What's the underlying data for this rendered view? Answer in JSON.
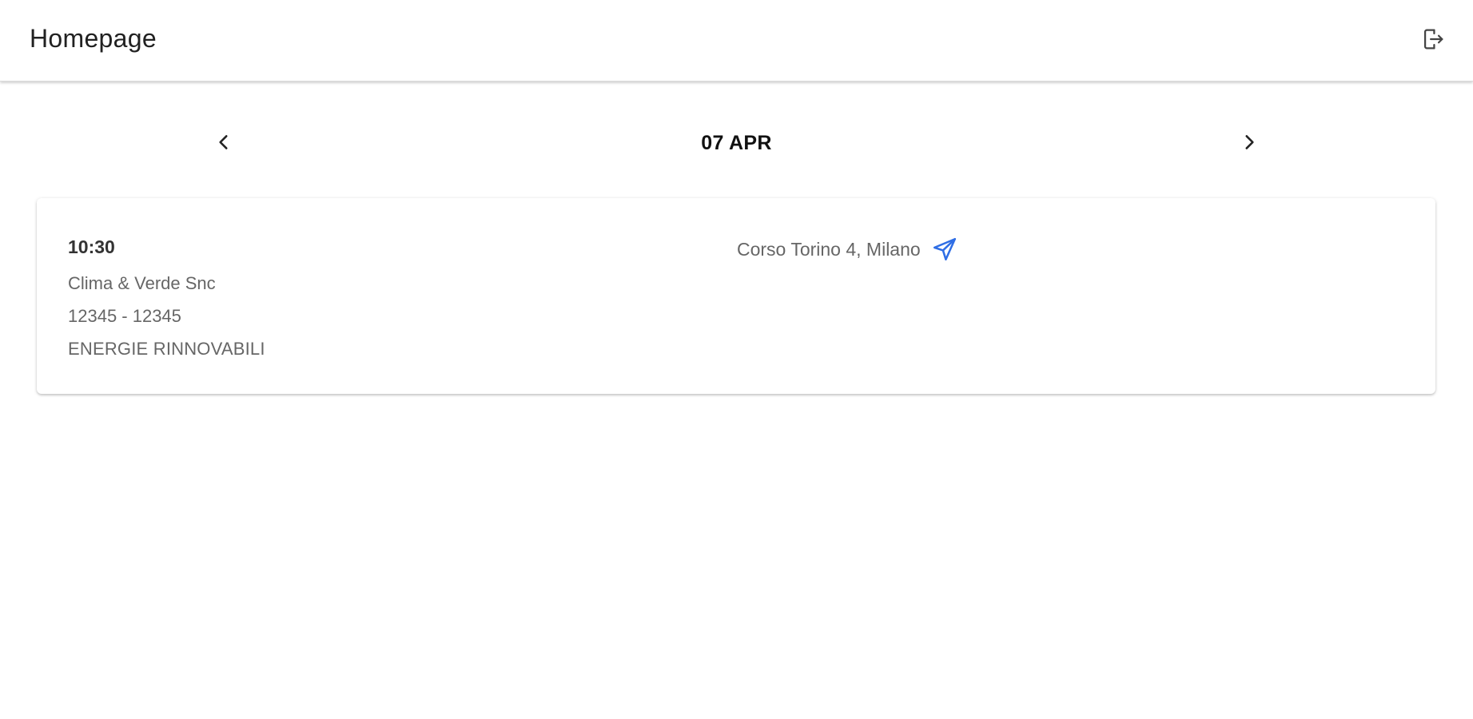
{
  "header": {
    "title": "Homepage",
    "logout_icon": "logout-icon"
  },
  "date_nav": {
    "current_date": "07 APR",
    "prev_icon": "chevron-left-icon",
    "next_icon": "chevron-right-icon"
  },
  "appointments": [
    {
      "time": "10:30",
      "company": "Clima & Verde Snc",
      "code": "12345 - 12345",
      "category": "ENERGIE RINNOVABILI",
      "address": "Corso Torino 4, Milano",
      "navigate_icon": "navigation-arrow-icon",
      "navigate_icon_color": "#2f6ee5"
    }
  ]
}
